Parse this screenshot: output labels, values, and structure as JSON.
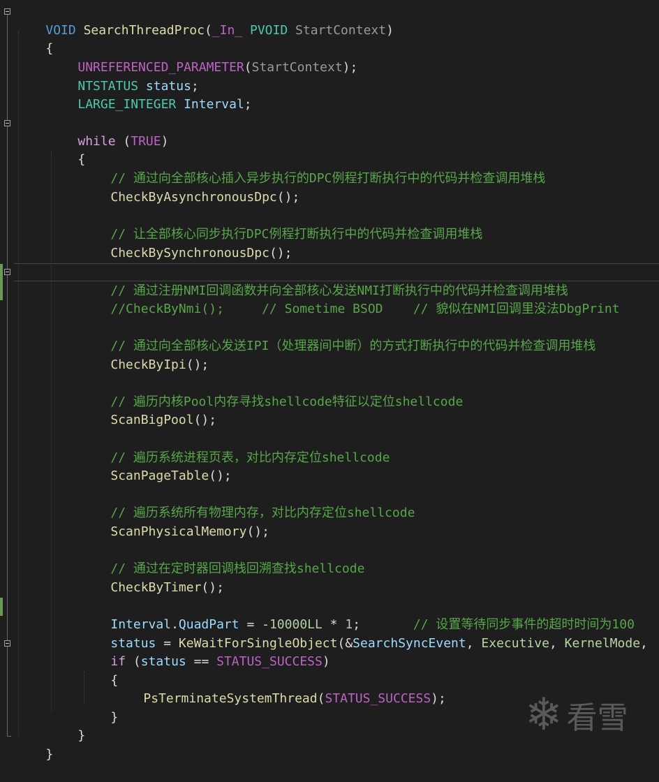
{
  "code": {
    "line1": {
      "void": "VOID",
      "fn": "SearchThreadProc",
      "open": "(",
      "in": "_In_",
      "ptype": "PVOID",
      "param": "StartContext",
      "close": ")"
    },
    "line2": "{",
    "line3": {
      "macro": "UNREFERENCED_PARAMETER",
      "open": "(",
      "param": "StartContext",
      "close": ");"
    },
    "line4": {
      "type": "NTSTATUS",
      "var": "status",
      "end": ";"
    },
    "line5": {
      "type": "LARGE_INTEGER",
      "var": "Interval",
      "end": ";"
    },
    "line6": {
      "kw": "while",
      "open": " (",
      "arg": "TRUE",
      "close": ")"
    },
    "line7": "{",
    "line8": "// 通过向全部核心插入异步执行的DPC例程打断执行中的代码并检查调用堆栈",
    "line9": {
      "fn": "CheckByAsynchronousDpc",
      "end": "();"
    },
    "line10": "// 让全部核心同步执行DPC例程打断执行中的代码并检查调用堆栈",
    "line11": {
      "fn": "CheckBySynchronousDpc",
      "end": "();"
    },
    "line12": "// 通过注册NMI回调函数并向全部核心发送NMI打断执行中的代码并检查调用堆栈",
    "line13": "//CheckByNmi();     // Sometime BSOD    // 貌似在NMI回调里没法DbgPrint",
    "line14": "// 通过向全部核心发送IPI（处理器间中断）的方式打断执行中的代码并检查调用堆栈",
    "line15": {
      "fn": "CheckByIpi",
      "end": "();"
    },
    "line16": "// 遍历内核Pool内存寻找shellcode特征以定位shellcode",
    "line17": {
      "fn": "ScanBigPool",
      "end": "();"
    },
    "line18": "// 遍历系统进程页表，对比内存定位shellcode",
    "line19": {
      "fn": "ScanPageTable",
      "end": "();"
    },
    "line20": "// 遍历系统所有物理内存，对比内存定位shellcode",
    "line21": {
      "fn": "ScanPhysicalMemory",
      "end": "();"
    },
    "line22": "// 通过在定时器回调栈回溯查找shellcode",
    "line23": {
      "fn": "CheckByTimer",
      "end": "();"
    },
    "line24": {
      "var": "Interval",
      "dot": ".",
      "member": "QuadPart",
      "op": " = -",
      "num": "10000LL",
      "op2": " * ",
      "num2": "1",
      "end": ";",
      "spaces": "       ",
      "cmt": "// 设置等待同步事件的超时时间为100"
    },
    "line25": {
      "var": "status",
      "op": " = ",
      "fn": "KeWaitForSingleObject",
      "open": "(&",
      "arg1": "SearchSyncEvent",
      "sep1": ", ",
      "arg2": "Executive",
      "sep2": ", ",
      "arg3": "KernelMode",
      "sep3": ","
    },
    "line26": {
      "kw": "if",
      "open": " (",
      "var": "status",
      "op": " == ",
      "val": "STATUS_SUCCESS",
      "close": ")"
    },
    "line27": "{",
    "line28": {
      "fn": "PsTerminateSystemThread",
      "open": "(",
      "val": "STATUS_SUCCESS",
      "close": ");"
    },
    "line29": "}",
    "line30": "}",
    "line31": "}"
  },
  "watermark": {
    "text": "看雪",
    "icon": "snowflake-icon"
  }
}
